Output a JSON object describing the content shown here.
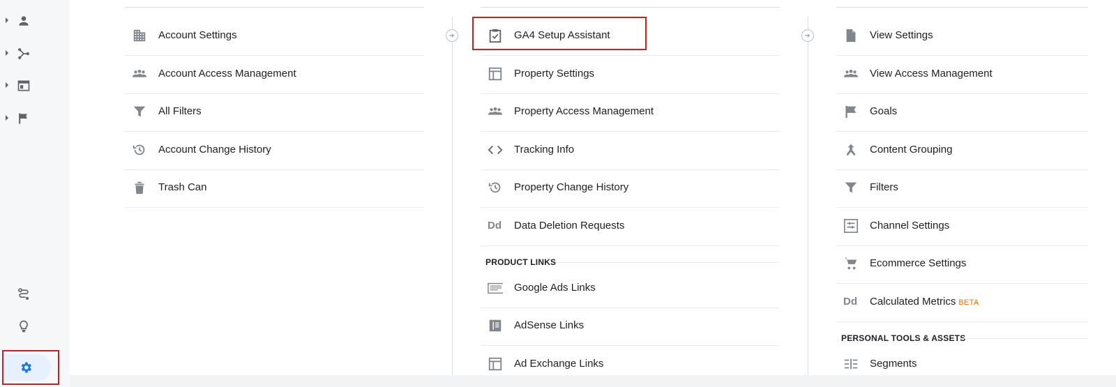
{
  "sidebar": {
    "items": [
      {
        "icon": "person-icon"
      },
      {
        "icon": "acquisition-icon"
      },
      {
        "icon": "behavior-icon"
      },
      {
        "icon": "flag-icon"
      }
    ],
    "bottom": [
      {
        "icon": "route-icon"
      },
      {
        "icon": "lightbulb-icon"
      },
      {
        "icon": "gear-icon"
      }
    ]
  },
  "account": {
    "items": [
      {
        "label": "Account Settings",
        "icon": "building-icon"
      },
      {
        "label": "Account Access Management",
        "icon": "people-icon"
      },
      {
        "label": "All Filters",
        "icon": "filter-icon"
      },
      {
        "label": "Account Change History",
        "icon": "history-icon"
      },
      {
        "label": "Trash Can",
        "icon": "trash-icon"
      }
    ]
  },
  "property": {
    "items": [
      {
        "label": "GA4 Setup Assistant",
        "icon": "clipboard-check-icon"
      },
      {
        "label": "Property Settings",
        "icon": "layout-icon"
      },
      {
        "label": "Property Access Management",
        "icon": "people-icon"
      },
      {
        "label": "Tracking Info",
        "icon": "code-icon"
      },
      {
        "label": "Property Change History",
        "icon": "history-icon"
      },
      {
        "label": "Data Deletion Requests",
        "icon": "dd-icon",
        "icon_text": "Dd"
      }
    ],
    "section_product_links": "PRODUCT LINKS",
    "links": [
      {
        "label": "Google Ads Links",
        "icon": "ads-icon"
      },
      {
        "label": "AdSense Links",
        "icon": "adsense-icon"
      },
      {
        "label": "Ad Exchange Links",
        "icon": "adexchange-icon"
      }
    ]
  },
  "view": {
    "items": [
      {
        "label": "View Settings",
        "icon": "document-icon"
      },
      {
        "label": "View Access Management",
        "icon": "people-icon"
      },
      {
        "label": "Goals",
        "icon": "flag-icon"
      },
      {
        "label": "Content Grouping",
        "icon": "merge-icon"
      },
      {
        "label": "Filters",
        "icon": "filter-icon"
      },
      {
        "label": "Channel Settings",
        "icon": "channel-icon"
      },
      {
        "label": "Ecommerce Settings",
        "icon": "cart-icon"
      },
      {
        "label": "Calculated Metrics",
        "icon": "dd-icon",
        "icon_text": "Dd",
        "badge": "BETA"
      }
    ],
    "section_personal": "PERSONAL TOOLS & ASSETS",
    "tools": [
      {
        "label": "Segments",
        "icon": "segments-icon"
      }
    ]
  },
  "colors": {
    "accent": "#1a73e8",
    "highlight": "#c5221f",
    "icon": "#80868b",
    "beta": "#e37400"
  }
}
